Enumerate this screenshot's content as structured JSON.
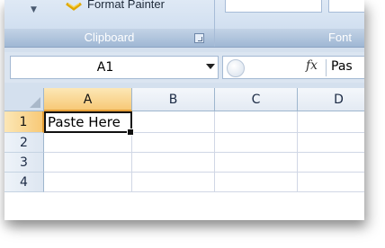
{
  "ribbon": {
    "format_painter_label": "Format Painter",
    "groups": [
      {
        "label": "Clipboard"
      },
      {
        "label": "Font"
      }
    ]
  },
  "formula_bar": {
    "name_box_value": "A1",
    "fx_label": "fx",
    "content": "Pas"
  },
  "grid": {
    "columns": [
      "A",
      "B",
      "C",
      "D"
    ],
    "rows": [
      "1",
      "2",
      "3",
      "4"
    ],
    "active_cell": "A1",
    "cells": {
      "A1": "Paste Here"
    }
  },
  "colors": {
    "active_header": "#f7c977",
    "ribbon_bg": "#c8d9ed"
  }
}
